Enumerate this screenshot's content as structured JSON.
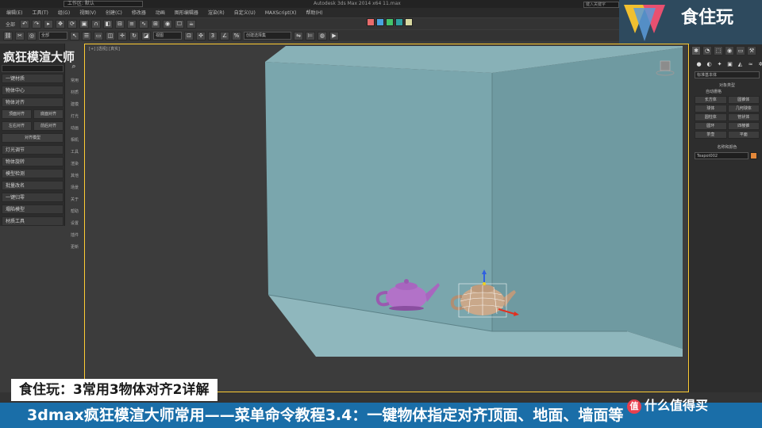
{
  "window": {
    "title": "Autodesk 3ds Max 2014 x64   11.max",
    "workspace": "工作区: 默认",
    "help_search": "键入关键字"
  },
  "menu": [
    "编辑(E)",
    "工具(T)",
    "组(G)",
    "视图(V)",
    "创建(C)",
    "修改器",
    "动画",
    "图形编辑器",
    "渲染(R)",
    "自定义(U)",
    "MAXScript(X)",
    "帮助(H)"
  ],
  "toolbar1": {
    "tools": [
      "撤消",
      "重做",
      "选择",
      "移动",
      "旋转",
      "缩放",
      "渲染",
      "材质"
    ],
    "select_filter": "全部"
  },
  "toolbar2": {
    "ref_coord": "视图",
    "named_selection": "创建选择集"
  },
  "swatch_colors": [
    "#e86c6c",
    "#4aa3e0",
    "#44c46a",
    "#2fa0a0",
    "#d8d8a0"
  ],
  "brand": {
    "logo_text": "食住玩"
  },
  "left_panel": {
    "title": "疯狂模渲大师",
    "items": [
      "一键材质",
      "物体中心",
      "物体对齐"
    ],
    "sub_rows": [
      [
        "顶面对齐",
        "底面对齐"
      ],
      [
        "左右对齐",
        "前后对齐"
      ]
    ],
    "single": "对齐模型",
    "items2": [
      "灯光调节",
      "物体旋转",
      "模型检测",
      "批量改名",
      "一键归零",
      "塌陷模型",
      "材质工具"
    ],
    "side_tabs": [
      "常用",
      "材质",
      "建模",
      "灯光",
      "动画",
      "相机",
      "工具",
      "渲染",
      "其他",
      "场景",
      "关于",
      "帮助",
      "设置",
      "插件",
      "更新"
    ]
  },
  "viewport": {
    "label": "[+] [透视] [真实]",
    "room_wall_color": "#7aa6ad",
    "teapot_purple": "#b272c8",
    "teapot_selected": "#c9a88a"
  },
  "right_panel": {
    "tabs": [
      "创建",
      "修改",
      "层次",
      "运动",
      "显示",
      "工具"
    ],
    "category": "标准基本体",
    "group_title": "对象类型",
    "autogrid": "自动栅格",
    "buttons": [
      "长方体",
      "圆锥体",
      "球体",
      "几何球体",
      "圆柱体",
      "管状体",
      "圆环",
      "四棱锥",
      "茶壶",
      "平面"
    ],
    "name_title": "名称和颜色",
    "object_name": "Teapot002"
  },
  "captions": {
    "top": "食住玩：3常用3物体对齐2详解",
    "bottom": "3dmax疯狂模渲大师常用——菜单命令教程3.4：一键物体指定对齐顶面、地面、墙面等"
  },
  "watermark": {
    "badge": "值",
    "text": "什么值得买"
  }
}
